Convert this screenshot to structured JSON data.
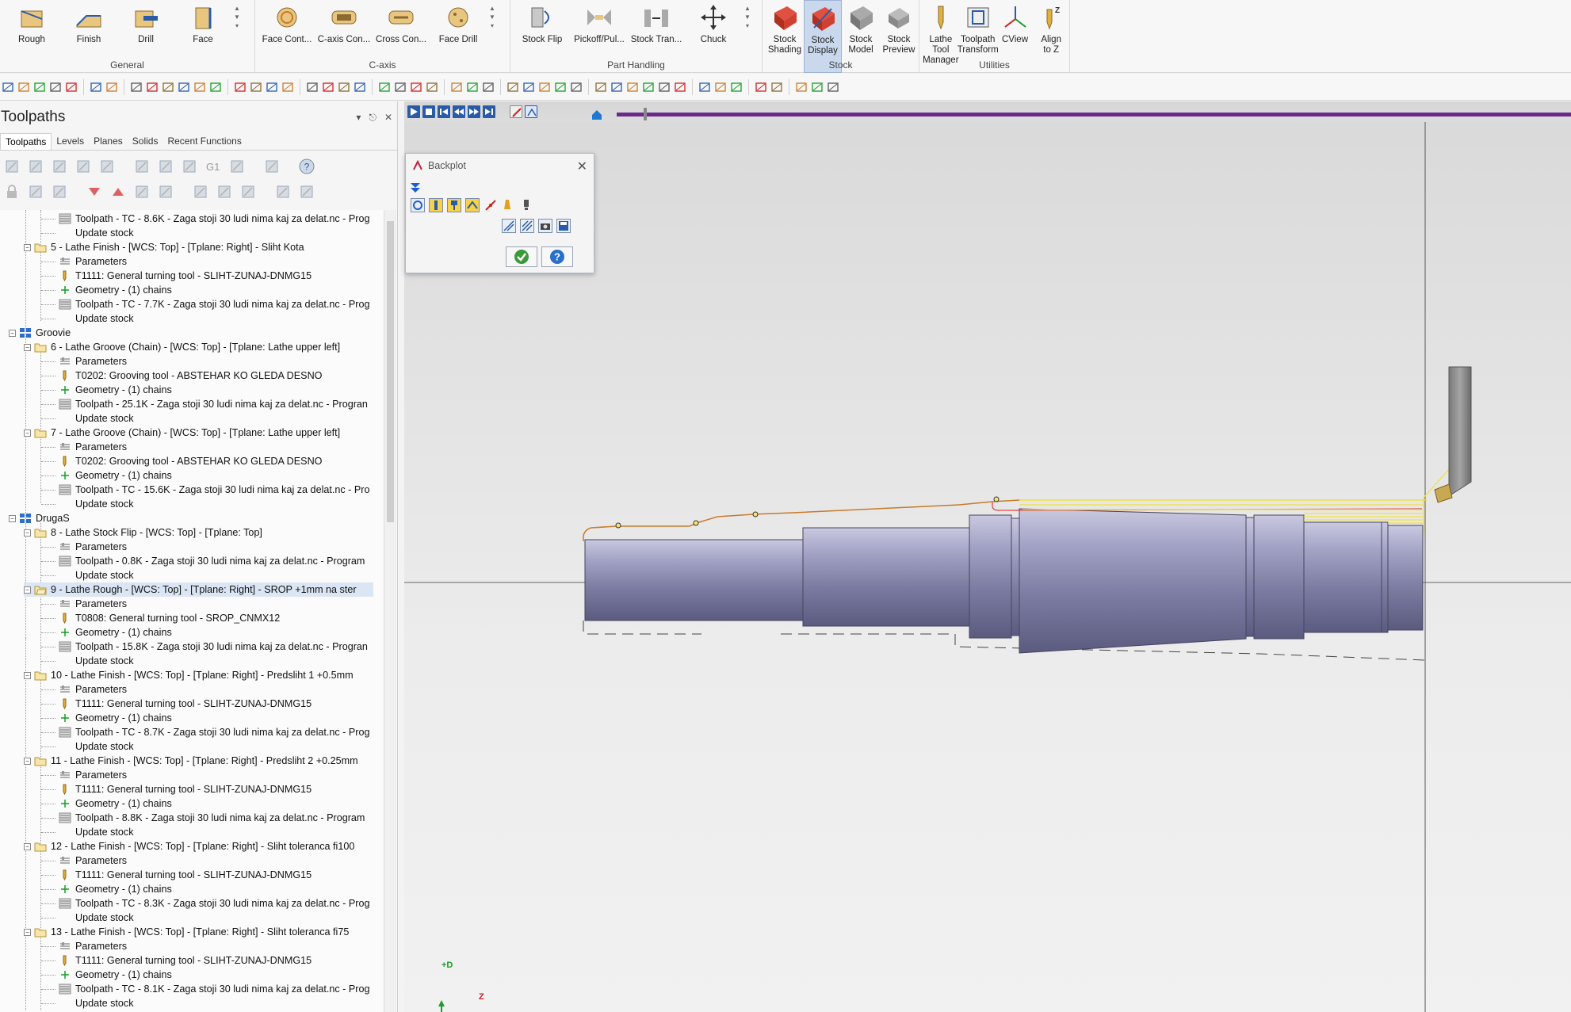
{
  "ribbon": {
    "groups": [
      {
        "label": "General",
        "buttons": [
          {
            "label": "Rough",
            "icon": "lathe-rough-icon"
          },
          {
            "label": "Finish",
            "icon": "lathe-finish-icon"
          },
          {
            "label": "Drill",
            "icon": "lathe-drill-icon"
          },
          {
            "label": "Face",
            "icon": "lathe-face-icon"
          }
        ]
      },
      {
        "label": "C-axis",
        "buttons": [
          {
            "label": "Face Cont...",
            "icon": "face-contour-icon"
          },
          {
            "label": "C-axis Con...",
            "icon": "c-axis-contour-icon"
          },
          {
            "label": "Cross Con...",
            "icon": "cross-contour-icon"
          },
          {
            "label": "Face Drill",
            "icon": "face-drill-icon"
          }
        ]
      },
      {
        "label": "Part Handling",
        "buttons": [
          {
            "label": "Stock Flip",
            "icon": "stock-flip-icon"
          },
          {
            "label": "Pickoff/Pul...",
            "icon": "pickoff-pull-icon"
          },
          {
            "label": "Stock Tran...",
            "icon": "stock-transfer-icon"
          },
          {
            "label": "Chuck",
            "icon": "chuck-icon"
          }
        ]
      },
      {
        "label": "Stock",
        "buttons": [
          {
            "label": "Stock\nShading",
            "icon": "stock-shading-icon"
          },
          {
            "label": "Stock\nDisplay",
            "icon": "stock-display-icon"
          },
          {
            "label": "Stock\nModel",
            "icon": "stock-model-icon"
          },
          {
            "label": "Stock\nPreview",
            "icon": "stock-preview-icon"
          }
        ]
      },
      {
        "label": "Utilities",
        "buttons": [
          {
            "label": "Lathe Tool\nManager",
            "icon": "lathe-tool-manager-icon"
          },
          {
            "label": "Toolpath\nTransform",
            "icon": "toolpath-transform-icon"
          },
          {
            "label": "CView",
            "icon": "cview-icon"
          },
          {
            "label": "Align\nto Z",
            "icon": "align-to-z-icon"
          }
        ]
      }
    ]
  },
  "panel": {
    "title": "Toolpaths",
    "tabs": [
      "Toolpaths",
      "Levels",
      "Planes",
      "Solids",
      "Recent Functions"
    ]
  },
  "tree": {
    "rows": [
      {
        "t": "Toolpath - TC - 8.6K - Zaga stoji 30 ludi nima kaj za delat.nc - Prog",
        "lvl": 2,
        "icon": "toolpath"
      },
      {
        "t": "Update stock",
        "lvl": 2,
        "icon": "none"
      },
      {
        "t": "5 - Lathe Finish - [WCS: Top] - [Tplane: Right] - Sliht Kota",
        "lvl": 1,
        "icon": "folder"
      },
      {
        "t": "Parameters",
        "lvl": 2,
        "icon": "params"
      },
      {
        "t": "T1111: General turning tool - SLIHT-ZUNAJ-DNMG15",
        "lvl": 2,
        "icon": "tool"
      },
      {
        "t": "Geometry - (1) chains",
        "lvl": 2,
        "icon": "geometry"
      },
      {
        "t": "Toolpath - TC - 7.7K - Zaga stoji 30 ludi nima kaj za delat.nc - Prog",
        "lvl": 2,
        "icon": "toolpath"
      },
      {
        "t": "Update stock",
        "lvl": 2,
        "icon": "none"
      },
      {
        "t": "Groovie",
        "lvl": 0,
        "icon": "group"
      },
      {
        "t": "6 - Lathe Groove (Chain) - [WCS: Top] - [Tplane: Lathe upper left]",
        "lvl": 1,
        "icon": "folder"
      },
      {
        "t": "Parameters",
        "lvl": 2,
        "icon": "params"
      },
      {
        "t": "T0202: Grooving tool - ABSTEHAR KO GLEDA DESNO",
        "lvl": 2,
        "icon": "tool"
      },
      {
        "t": "Geometry - (1) chains",
        "lvl": 2,
        "icon": "geometry"
      },
      {
        "t": "Toolpath - 25.1K - Zaga stoji 30 ludi nima kaj za delat.nc - Progran",
        "lvl": 2,
        "icon": "toolpath"
      },
      {
        "t": "Update stock",
        "lvl": 2,
        "icon": "none"
      },
      {
        "t": "7 - Lathe Groove (Chain) - [WCS: Top] - [Tplane: Lathe upper left]",
        "lvl": 1,
        "icon": "folder"
      },
      {
        "t": "Parameters",
        "lvl": 2,
        "icon": "params"
      },
      {
        "t": "T0202: Grooving tool - ABSTEHAR KO GLEDA DESNO",
        "lvl": 2,
        "icon": "tool"
      },
      {
        "t": "Geometry - (1) chains",
        "lvl": 2,
        "icon": "geometry"
      },
      {
        "t": "Toolpath - TC - 15.6K - Zaga stoji 30 ludi nima kaj za delat.nc - Pro",
        "lvl": 2,
        "icon": "toolpath"
      },
      {
        "t": "Update stock",
        "lvl": 2,
        "icon": "none"
      },
      {
        "t": "DrugaS",
        "lvl": 0,
        "icon": "group"
      },
      {
        "t": "8 - Lathe Stock Flip - [WCS: Top] - [Tplane: Top]",
        "lvl": 1,
        "icon": "folder"
      },
      {
        "t": "Parameters",
        "lvl": 2,
        "icon": "params"
      },
      {
        "t": "Toolpath - 0.8K - Zaga stoji 30 ludi nima kaj za delat.nc - Program",
        "lvl": 2,
        "icon": "toolpath"
      },
      {
        "t": "Update stock",
        "lvl": 2,
        "icon": "none"
      },
      {
        "t": "9 - Lathe Rough - [WCS: Top] - [Tplane: Right] - SROP +1mm na ster",
        "lvl": 1,
        "icon": "folder-open",
        "sel": true
      },
      {
        "t": "Parameters",
        "lvl": 2,
        "icon": "params"
      },
      {
        "t": "T0808: General turning tool - SROP_CNMX12",
        "lvl": 2,
        "icon": "tool"
      },
      {
        "t": "Geometry - (1) chains",
        "lvl": 2,
        "icon": "geometry"
      },
      {
        "t": "Toolpath - 15.8K - Zaga stoji 30 ludi nima kaj za delat.nc - Progran",
        "lvl": 2,
        "icon": "toolpath"
      },
      {
        "t": "Update stock",
        "lvl": 2,
        "icon": "none"
      },
      {
        "t": "10 - Lathe Finish - [WCS: Top] - [Tplane: Right] - Predsliht 1 +0.5mm",
        "lvl": 1,
        "icon": "folder"
      },
      {
        "t": "Parameters",
        "lvl": 2,
        "icon": "params"
      },
      {
        "t": "T1111: General turning tool - SLIHT-ZUNAJ-DNMG15",
        "lvl": 2,
        "icon": "tool"
      },
      {
        "t": "Geometry - (1) chains",
        "lvl": 2,
        "icon": "geometry"
      },
      {
        "t": "Toolpath - TC - 8.7K - Zaga stoji 30 ludi nima kaj za delat.nc - Prog",
        "lvl": 2,
        "icon": "toolpath"
      },
      {
        "t": "Update stock",
        "lvl": 2,
        "icon": "none"
      },
      {
        "t": "11 - Lathe Finish - [WCS: Top] - [Tplane: Right] - Predsliht 2 +0.25mm",
        "lvl": 1,
        "icon": "folder"
      },
      {
        "t": "Parameters",
        "lvl": 2,
        "icon": "params"
      },
      {
        "t": "T1111: General turning tool - SLIHT-ZUNAJ-DNMG15",
        "lvl": 2,
        "icon": "tool"
      },
      {
        "t": "Geometry - (1) chains",
        "lvl": 2,
        "icon": "geometry"
      },
      {
        "t": "Toolpath - 8.8K - Zaga stoji 30 ludi nima kaj za delat.nc - Program",
        "lvl": 2,
        "icon": "toolpath"
      },
      {
        "t": "Update stock",
        "lvl": 2,
        "icon": "none"
      },
      {
        "t": "12 - Lathe Finish - [WCS: Top] - [Tplane: Right] - Sliht toleranca fi100",
        "lvl": 1,
        "icon": "folder"
      },
      {
        "t": "Parameters",
        "lvl": 2,
        "icon": "params"
      },
      {
        "t": "T1111: General turning tool - SLIHT-ZUNAJ-DNMG15",
        "lvl": 2,
        "icon": "tool"
      },
      {
        "t": "Geometry - (1) chains",
        "lvl": 2,
        "icon": "geometry"
      },
      {
        "t": "Toolpath - TC - 8.3K - Zaga stoji 30 ludi nima kaj za delat.nc - Prog",
        "lvl": 2,
        "icon": "toolpath"
      },
      {
        "t": "Update stock",
        "lvl": 2,
        "icon": "none"
      },
      {
        "t": "13 - Lathe Finish - [WCS: Top] - [Tplane: Right] - Sliht toleranca fi75",
        "lvl": 1,
        "icon": "folder"
      },
      {
        "t": "Parameters",
        "lvl": 2,
        "icon": "params"
      },
      {
        "t": "T1111: General turning tool - SLIHT-ZUNAJ-DNMG15",
        "lvl": 2,
        "icon": "tool"
      },
      {
        "t": "Geometry - (1) chains",
        "lvl": 2,
        "icon": "geometry"
      },
      {
        "t": "Toolpath - TC - 8.1K - Zaga stoji 30 ludi nima kaj za delat.nc - Prog",
        "lvl": 2,
        "icon": "toolpath"
      },
      {
        "t": "Update stock",
        "lvl": 2,
        "icon": "none"
      }
    ]
  },
  "backplot": {
    "title": "Backplot"
  },
  "viewport": {
    "axis_d": "+D",
    "axis_z": "Z"
  },
  "colors": {
    "accent": "#2a5ba8",
    "part": "#8585a8",
    "toolpath": "#f0e040",
    "axis_d": "#1a9c2a",
    "axis_z": "#c8202a"
  }
}
